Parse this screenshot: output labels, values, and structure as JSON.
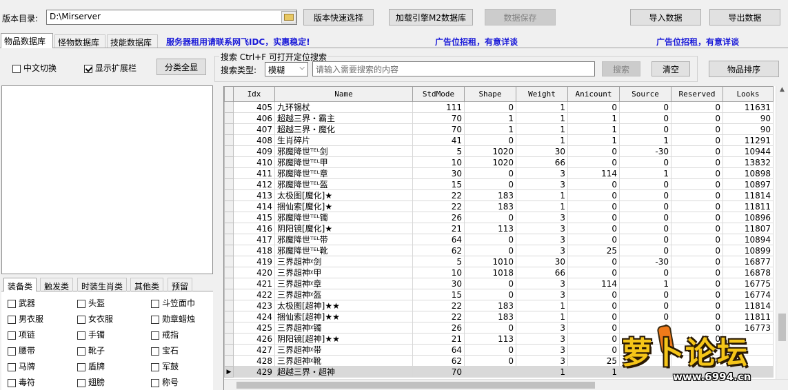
{
  "toolbar": {
    "version_dir_label": "版本目录:",
    "version_dir_value": "D:\\Mirserver",
    "quick_select": "版本快速选择",
    "load_engine": "加载引擎M2数据库",
    "save_data": "数据保存",
    "import_data": "导入数据",
    "export_data": "导出数据"
  },
  "tabs": [
    "物品数据库",
    "怪物数据库",
    "技能数据库"
  ],
  "ads": {
    "server": "服务器租用请联系网飞IDC，实惠稳定!",
    "ad1": "广告位招租，有意详谈",
    "ad2": "广告位招租，有意详谈"
  },
  "options": {
    "chinese_switch": "中文切换",
    "show_ext": "显示扩展栏",
    "show_all": "分类全显"
  },
  "search": {
    "title": "搜索  Ctrl+F 可打开定位搜索",
    "type_label": "搜索类型:",
    "type_value": "模糊",
    "placeholder": "请输入需要搜索的内容",
    "search_btn": "搜索",
    "clear_btn": "清空",
    "sort_btn": "物品排序"
  },
  "category_tabs": [
    "装备类",
    "触发类",
    "时装生肖类",
    "其他类",
    "预留"
  ],
  "categories": [
    [
      "武器",
      "头盔",
      "斗笠面巾"
    ],
    [
      "男衣服",
      "女衣服",
      "勋章蜡烛"
    ],
    [
      "项链",
      "手镯",
      "戒指"
    ],
    [
      "腰带",
      "靴子",
      "宝石"
    ],
    [
      "马牌",
      "盾牌",
      "军鼓"
    ],
    [
      "毒符",
      "翅膀",
      "称号"
    ]
  ],
  "columns": [
    "Idx",
    "Name",
    "StdMode",
    "Shape",
    "Weight",
    "Anicount",
    "Source",
    "Reserved",
    "Looks"
  ],
  "rows": [
    [
      "405",
      "九环锡杖",
      "111",
      "0",
      "1",
      "0",
      "0",
      "0",
      "11631"
    ],
    [
      "406",
      "超越三界・霸主",
      "70",
      "1",
      "1",
      "1",
      "0",
      "0",
      "90"
    ],
    [
      "407",
      "超越三界・魔化",
      "70",
      "1",
      "1",
      "1",
      "0",
      "0",
      "90"
    ],
    [
      "408",
      "生肖碎片",
      "41",
      "0",
      "1",
      "1",
      "1",
      "0",
      "11291"
    ],
    [
      "409",
      "邪魔降世ᵀᴱᴸ剑",
      "5",
      "1020",
      "30",
      "0",
      "-30",
      "0",
      "10944"
    ],
    [
      "410",
      "邪魔降世ᵀᴱᴸ甲",
      "10",
      "1020",
      "66",
      "0",
      "0",
      "0",
      "13832"
    ],
    [
      "411",
      "邪魔降世ᵀᴱᴸ章",
      "30",
      "0",
      "3",
      "114",
      "1",
      "0",
      "10898"
    ],
    [
      "412",
      "邪魔降世ᵀᴱᴸ盔",
      "15",
      "0",
      "3",
      "0",
      "0",
      "0",
      "10897"
    ],
    [
      "413",
      "太极图[魔化]★",
      "22",
      "183",
      "1",
      "0",
      "0",
      "0",
      "11814"
    ],
    [
      "414",
      "捆仙索[魔化]★",
      "22",
      "183",
      "1",
      "0",
      "0",
      "0",
      "11811"
    ],
    [
      "415",
      "邪魔降世ᵀᴱᴸ镯",
      "26",
      "0",
      "3",
      "0",
      "0",
      "0",
      "10896"
    ],
    [
      "416",
      "阴阳镜[魔化]★",
      "21",
      "113",
      "3",
      "0",
      "0",
      "0",
      "11807"
    ],
    [
      "417",
      "邪魔降世ᵀᴱᴸ带",
      "64",
      "0",
      "3",
      "0",
      "0",
      "0",
      "10894"
    ],
    [
      "418",
      "邪魔降世ᵀᴱᴸ靴",
      "62",
      "0",
      "3",
      "25",
      "0",
      "0",
      "10899"
    ],
    [
      "419",
      "三界超神ᵡ剑",
      "5",
      "1010",
      "30",
      "0",
      "-30",
      "0",
      "16877"
    ],
    [
      "420",
      "三界超神ᵡ甲",
      "10",
      "1018",
      "66",
      "0",
      "0",
      "0",
      "16878"
    ],
    [
      "421",
      "三界超神ᵡ章",
      "30",
      "0",
      "3",
      "114",
      "1",
      "0",
      "16775"
    ],
    [
      "422",
      "三界超神ᵡ盔",
      "15",
      "0",
      "3",
      "0",
      "0",
      "0",
      "16774"
    ],
    [
      "423",
      "太极图[超神]★★",
      "22",
      "183",
      "1",
      "0",
      "0",
      "0",
      "11814"
    ],
    [
      "424",
      "捆仙索[超神]★★",
      "22",
      "183",
      "1",
      "0",
      "0",
      "0",
      "11811"
    ],
    [
      "425",
      "三界超神ᵡ镯",
      "26",
      "0",
      "3",
      "0",
      "0",
      "0",
      "16773"
    ],
    [
      "426",
      "阴阳镜[超神]★★",
      "21",
      "113",
      "3",
      "0",
      "0",
      "0",
      ""
    ],
    [
      "427",
      "三界超神ᵡ带",
      "64",
      "0",
      "3",
      "0",
      "",
      "",
      ""
    ],
    [
      "428",
      "三界超神ᵡ靴",
      "62",
      "0",
      "3",
      "25",
      "",
      "",
      ""
    ],
    [
      "429",
      "超越三界・超神",
      "70",
      "",
      "1",
      "1",
      "",
      "",
      ""
    ]
  ],
  "selected_row": 24,
  "watermark": {
    "logo": "萝卜论坛",
    "url": "www.6994.cn"
  }
}
